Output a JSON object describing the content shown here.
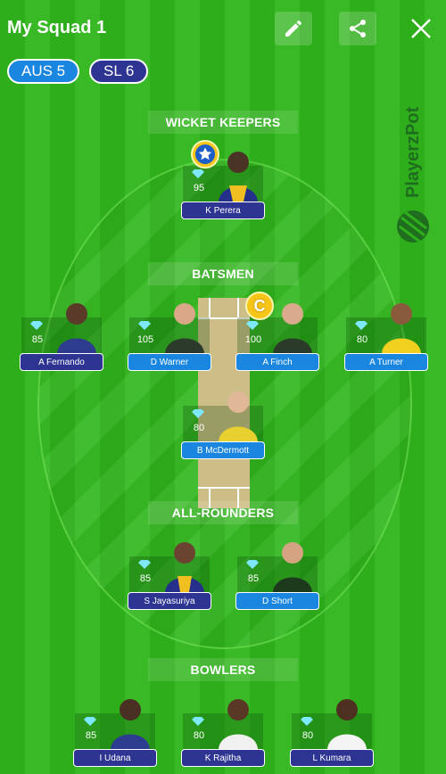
{
  "header": {
    "title": "My Squad 1"
  },
  "teams": [
    {
      "label": "AUS 5",
      "color": "#1b86e0"
    },
    {
      "label": "SL 6",
      "color": "#2d3491"
    }
  ],
  "brand": {
    "text": "PlayerzPot"
  },
  "sections": {
    "wicket_keepers": "WICKET KEEPERS",
    "batsmen": "BATSMEN",
    "all_rounders": "ALL-ROUNDERS",
    "bowlers": "BOWLERS"
  },
  "players": {
    "perera": {
      "name": "K Perera",
      "points": "95",
      "team": "SL"
    },
    "fernando": {
      "name": "A Fernando",
      "points": "85",
      "team": "SL"
    },
    "warner": {
      "name": "D Warner",
      "points": "105",
      "team": "AUS"
    },
    "finch": {
      "name": "A  Finch",
      "points": "100",
      "team": "AUS"
    },
    "turner": {
      "name": "A Turner",
      "points": "80",
      "team": "AUS"
    },
    "mcdermott": {
      "name": "B McDermott",
      "points": "80",
      "team": "AUS"
    },
    "jayasuriya": {
      "name": "S Jayasuriya",
      "points": "85",
      "team": "SL"
    },
    "short": {
      "name": "D Short",
      "points": "85",
      "team": "AUS"
    },
    "udana": {
      "name": "I Udana",
      "points": "85",
      "team": "SL"
    },
    "rajitha": {
      "name": "K Rajitha",
      "points": "80",
      "team": "SL"
    },
    "kumara": {
      "name": "L Kumara",
      "points": "80",
      "team": "SL"
    }
  },
  "badges": {
    "captain": "C"
  },
  "colors": {
    "sl": "#2d3491",
    "aus": "#1b86e0",
    "field": "#2fae1c",
    "pitch": "#cdbd86",
    "badge": "#f5c518"
  }
}
